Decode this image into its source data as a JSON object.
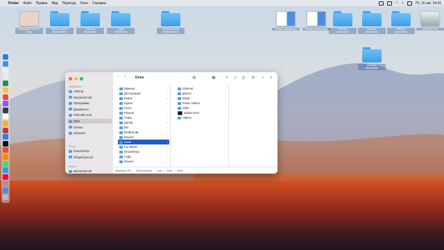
{
  "menubar": {
    "apple": "",
    "items": [
      "Finder",
      "Файл",
      "Правка",
      "Вид",
      "Переход",
      "Окно",
      "Справка"
    ],
    "clock": "Пт, 16 авг. 18:41"
  },
  "desktop": {
    "top_icons": [
      {
        "label": "ГЛАВНАЯ-TOP100-8.jpg",
        "kind": "thumb"
      },
      {
        "label": "Запись экрана\nнесохранено",
        "kind": "folder"
      },
      {
        "label": "Рабочие\nматериалы",
        "kind": "folder"
      },
      {
        "label": "Apple\nматериалы",
        "kind": "folder"
      },
      {
        "label": "Запись экрана\nнеобработано",
        "kind": "folder"
      },
      {
        "label": "Снимок экрана.png",
        "kind": "thumb"
      },
      {
        "label": "Снимок экрана.png",
        "kind": "thumb"
      },
      {
        "label": "Рабочие\nматериалы",
        "kind": "folder"
      },
      {
        "label": "Рабочие\nматериалы",
        "kind": "folder"
      },
      {
        "label": "Рабочие\nматериалы",
        "kind": "folder"
      },
      {
        "label": "Macintosh HD",
        "kind": "disk"
      }
    ],
    "second_row_icon": {
      "label": "Рабочие\nматериалы",
      "kind": "folder"
    }
  },
  "finder": {
    "title": "Done",
    "sidebar": {
      "favorites_header": "Избранное",
      "favorites": [
        "AirDrop",
        "Macintosh HD",
        "Программы",
        "Документы",
        "Рабочий стол",
        "Data",
        "Games",
        "Загрузки"
      ],
      "selected": "Data",
      "icloud_header": "iCloud",
      "icloud": [
        "iCloud Drive",
        "Общий доступ"
      ],
      "places_header": "Места",
      "places": [
        "Macintosh HD"
      ]
    },
    "column1": [
      "Важное",
      "Для музыки",
      "Книги",
      "Курсы",
      "Ноты",
      "Разное",
      "Темы",
      "Шутки",
      "bbl",
      "BroBroLab",
      "Davinci",
      "Done",
      "For Music",
      "GhowTemp",
      "Logic",
      "Movies"
    ],
    "column1_selected": "Done",
    "column2": [
      {
        "name": "channel",
        "kind": "folder",
        "chev": true
      },
      {
        "name": "games",
        "kind": "folder",
        "chev": true
      },
      {
        "name": "Music",
        "kind": "folder",
        "chev": true
      },
      {
        "name": "music videos",
        "kind": "folder",
        "chev": true
      },
      {
        "name": "other",
        "kind": "folder",
        "chev": true
      },
      {
        "name": "spain2.mov",
        "kind": "video",
        "chev": false
      },
      {
        "name": "Videos",
        "kind": "folder",
        "chev": true
      }
    ],
    "pathbar": [
      "Macintosh HD",
      "Пользователи",
      "mad",
      "Data",
      "Done"
    ],
    "toolbar": {
      "back": "‹",
      "forward": "›",
      "view_icon": "columns-view-icon",
      "group_icon": "group-icon",
      "share": "⇪",
      "tag": "◇",
      "action": "⊖",
      "search": "⌕",
      "more": "»"
    }
  }
}
